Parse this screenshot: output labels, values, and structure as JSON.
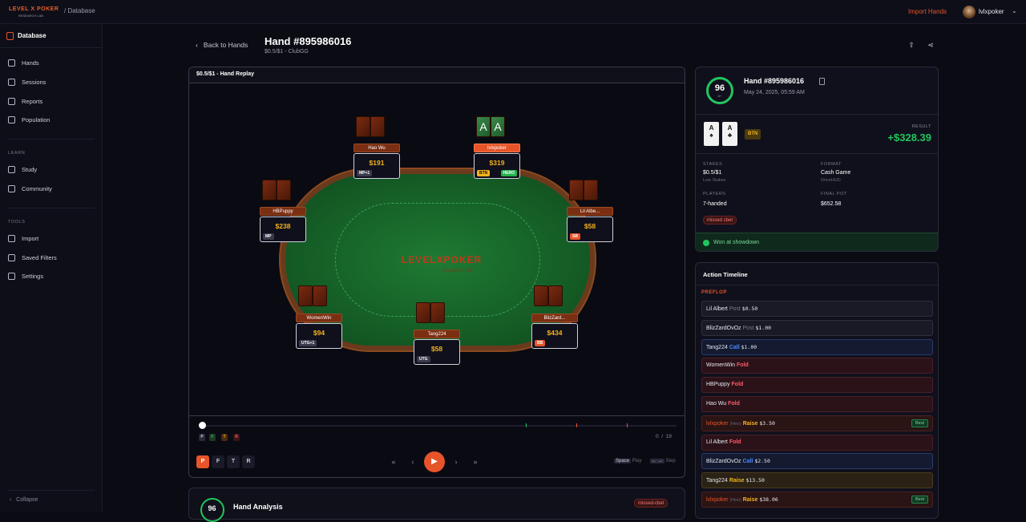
{
  "app": {
    "logo_text": "LEVEL X POKER",
    "logo_sub": "RESEARCH LAB",
    "breadcrumb": "/ Database",
    "import_hands": "Import Hands",
    "username": "lvlxpoker",
    "chevron": "⌄"
  },
  "sidebar": {
    "title": "Database",
    "main_items": [
      {
        "label": "Hands",
        "icon": "hands-icon"
      },
      {
        "label": "Sessions",
        "icon": "calendar-icon"
      },
      {
        "label": "Reports",
        "icon": "chart-icon"
      },
      {
        "label": "Population",
        "icon": "users-icon"
      }
    ],
    "learn_title": "LEARN",
    "learn_items": [
      {
        "label": "Study",
        "icon": "book-icon"
      },
      {
        "label": "Community",
        "icon": "chat-icon"
      }
    ],
    "tools_title": "TOOLS",
    "tools_items": [
      {
        "label": "Import",
        "icon": "upload-icon"
      },
      {
        "label": "Saved Filters",
        "icon": "filter-icon"
      },
      {
        "label": "Settings",
        "icon": "gear-icon"
      }
    ],
    "collapse": "Collapse"
  },
  "header": {
    "back": "Back to Hands",
    "title": "Hand #895986016",
    "subtitle": "$0.5/$1 - ClubGG"
  },
  "replay": {
    "title": "$0.5/$1 - Hand Replay",
    "table_logo": "LEVELXPOKER",
    "table_logo_sub": "RESEARCH LAB",
    "seats": [
      {
        "name": "Hao Wu",
        "stack": "$191",
        "position": "MP+1"
      },
      {
        "name": "lvlxpoker",
        "stack": "$319",
        "position": "BTN",
        "hero": "HERO",
        "cards": [
          "A",
          "A"
        ]
      },
      {
        "name": "HBPuppy",
        "stack": "$238",
        "position": "MP"
      },
      {
        "name": "Lil Albe...",
        "stack": "$58",
        "position": "SB"
      },
      {
        "name": "WomenWin",
        "stack": "$94",
        "position": "UTG+1"
      },
      {
        "name": "Tang224",
        "stack": "$58",
        "position": "UTG"
      },
      {
        "name": "BlizZard...",
        "stack": "$434",
        "position": "BB"
      }
    ],
    "mini_streets": [
      "P",
      "F",
      "T",
      "R"
    ],
    "counter_current": "0",
    "counter_sep": "/",
    "counter_total": "19",
    "streets": [
      "P",
      "F",
      "T",
      "R"
    ],
    "controls": {
      "first": "«",
      "prev": "‹",
      "play": "▶",
      "next": "›",
      "last": "»"
    },
    "kb_play_key": "Space",
    "kb_play_label": "Play",
    "kb_step_key": "← →",
    "kb_step_label": "Step"
  },
  "analysis": {
    "score": "96",
    "title": "Hand Analysis",
    "tag": "missed-cbet"
  },
  "summary": {
    "score": "96",
    "grade": "A+",
    "title": "Hand #895986016",
    "date": "May 24, 2025, 05:59 AM",
    "hero_cards": [
      {
        "rank": "A",
        "suit": "♠"
      },
      {
        "rank": "A",
        "suit": "♣"
      }
    ],
    "position": "BTN",
    "result_label": "RESULT",
    "result_value": "+$328.39",
    "stakes_label": "STAKES",
    "stakes_value": "$0.5/$1",
    "stakes_sub": "Low Stakes",
    "format_label": "FORMAT",
    "format_value": "Cash Game",
    "format_sub": "DriveHUD",
    "players_label": "PLAYERS",
    "players_value": "7-handed",
    "pot_label": "FINAL POT",
    "pot_value": "$652.58",
    "tag": "missed cbet",
    "showdown": "Won at showdown"
  },
  "timeline": {
    "title": "Action Timeline",
    "street": "PREFLOP",
    "hero_suffix": "(Hero)",
    "best": "Best",
    "actions": [
      {
        "player": "Lil Albert",
        "action": "Post",
        "amount": "$0.50",
        "kind": "post"
      },
      {
        "player": "BlizZardOvOz",
        "action": "Post",
        "amount": "$1.00",
        "kind": "post"
      },
      {
        "player": "Tang224",
        "action": "Call",
        "amount": "$1.00",
        "kind": "call"
      },
      {
        "player": "WomenWin",
        "action": "Fold",
        "amount": "",
        "kind": "fold"
      },
      {
        "player": "HBPuppy",
        "action": "Fold",
        "amount": "",
        "kind": "fold"
      },
      {
        "player": "Hao Wu",
        "action": "Fold",
        "amount": "",
        "kind": "fold"
      },
      {
        "player": "lvlxpoker",
        "action": "Raise",
        "amount": "$3.50",
        "kind": "heroraise"
      },
      {
        "player": "Lil Albert",
        "action": "Fold",
        "amount": "",
        "kind": "fold"
      },
      {
        "player": "BlizZardOvOz",
        "action": "Call",
        "amount": "$2.50",
        "kind": "call"
      },
      {
        "player": "Tang224",
        "action": "Raise",
        "amount": "$13.50",
        "kind": "raise"
      },
      {
        "player": "lvlxpoker",
        "action": "Raise",
        "amount": "$38.06",
        "kind": "heroraise"
      }
    ]
  },
  "colors": {
    "accent": "#e8542a",
    "win": "#22c55e",
    "stack": "#f5b21c",
    "call": "#4a8aff",
    "fold": "#ff5a6a"
  }
}
